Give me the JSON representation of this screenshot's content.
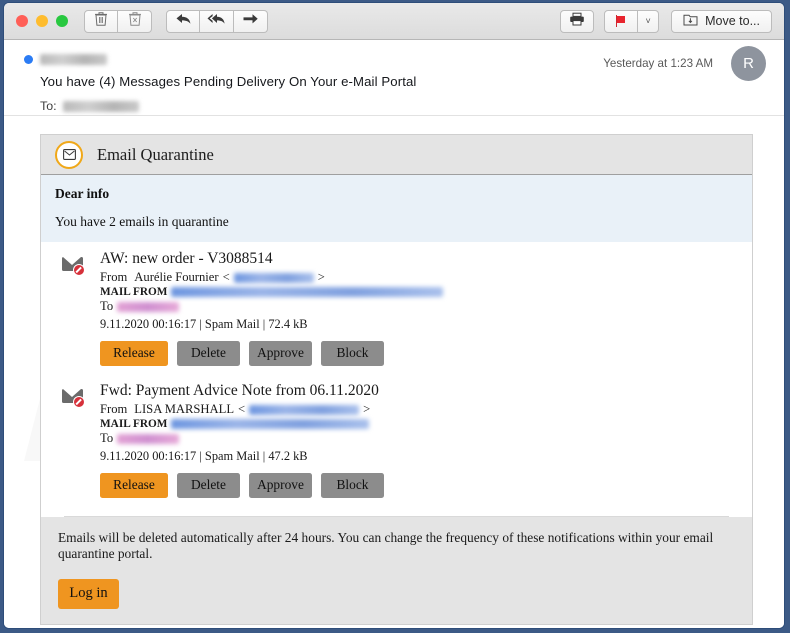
{
  "toolbar": {
    "traffic_lights": [
      {
        "name": "close",
        "color": "#ff5f57"
      },
      {
        "name": "minimize",
        "color": "#febc2e"
      },
      {
        "name": "zoom",
        "color": "#28c840"
      }
    ],
    "delete_icon": "trash-icon",
    "junk_icon": "junk-trash-icon",
    "reply_icon": "reply-arrow-icon",
    "reply_all_icon": "reply-all-arrow-icon",
    "forward_icon": "forward-arrow-icon",
    "print_icon": "printer-icon",
    "flag_icon": "red-flag-icon",
    "flag_chevron": "˅",
    "move_to_icon": "folder-move-icon",
    "move_to_label": "Move to..."
  },
  "message": {
    "sender_redacted": true,
    "sender_redact_width": 67,
    "subject": "You have (4) Messages Pending Delivery On Your e-Mail Portal",
    "to_label": "To:",
    "to_redact_width": 76,
    "date": "Yesterday at 1:23 AM",
    "avatar_initial": "R"
  },
  "quarantine": {
    "header_title": "Email Quarantine",
    "header_icon": "envelope-badge-icon",
    "greeting": "Dear info",
    "count_line": "You have 2 emails in quarantine",
    "emails": [
      {
        "icon": "blocked-envelope-icon",
        "subject": "AW: new order - V3088514",
        "from_label": "From",
        "from_name": "Aurélie Fournier",
        "angle_open": "<",
        "angle_close": ">",
        "from_address_redact_width": 80,
        "mail_from_label": "MAIL FROM",
        "mail_from_redact_width": 272,
        "to_label": "To",
        "to_redact_width": 62,
        "date": "9.11.2020 00:16:17 | Spam Mail | 72.4 kB",
        "buttons": [
          "Release",
          "Delete",
          "Approve",
          "Block"
        ]
      },
      {
        "icon": "blocked-envelope-icon",
        "subject": "Fwd: Payment Advice Note from 06.11.2020",
        "from_label": "From",
        "from_name": "LISA MARSHALL",
        "angle_open": "<",
        "angle_close": ">",
        "from_address_redact_width": 110,
        "mail_from_label": "MAIL FROM",
        "mail_from_redact_width": 198,
        "to_label": "To",
        "to_redact_width": 62,
        "date": "9.11.2020 00:16:17 | Spam Mail | 47.2 kB",
        "buttons": [
          "Release",
          "Delete",
          "Approve",
          "Block"
        ]
      }
    ],
    "footer_text": "Emails will be deleted automatically after 24 hours. You can change the frequency of these notifications within your email quarantine portal.",
    "login_label": "Log in"
  },
  "colors": {
    "accent_orange": "#ef9520",
    "button_gray": "#8c8c8c",
    "greet_background": "#e9f1f8",
    "card_header_background": "#e4e4e4",
    "window_border": "#2e4d79",
    "unread_dot": "#2b7cf4",
    "avatar_background": "#8e949e"
  }
}
